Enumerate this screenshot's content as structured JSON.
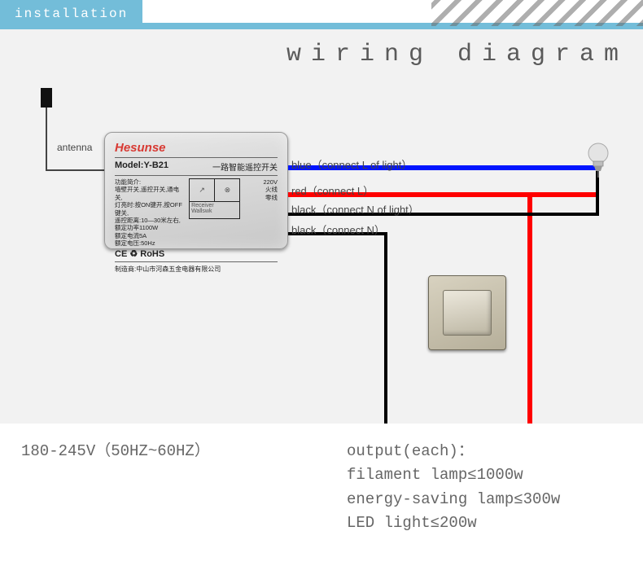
{
  "header": {
    "tab": "installation"
  },
  "title": "wiring diagram",
  "antenna_label": "antenna",
  "module": {
    "brand": "Hesunse",
    "model_label": "Model:",
    "model_value": "Y-B21",
    "cn_title": "一路智能遥控开关",
    "tiny": "功能简介:\n墙壁开关,遥控开关,通电关,\n灯亮时:按ON键开,按OFF键关,\n遥控距离:10—30米左右,\n额定功率1100W\n额定电流5A\n额定电压:50Hz",
    "box_rx": "Receiver",
    "box_wall": "Wallswk",
    "side": "220V\n火线\n零线",
    "icons": "CE ♻ RoHS",
    "foot": "制造商:中山市河森五金电器有限公司"
  },
  "wires": {
    "blue": "blue（connect L of light）",
    "red": "red（connect L）",
    "black1": "black（connect N of light）",
    "black2": "black（connect N）"
  },
  "footer": {
    "left": "180-245V（50HZ~60HZ）",
    "right_head": "output(each)：",
    "right_l1": "filament lamp≤1000w",
    "right_l2": "energy-saving lamp≤300w",
    "right_l3": "LED light≤200w"
  }
}
